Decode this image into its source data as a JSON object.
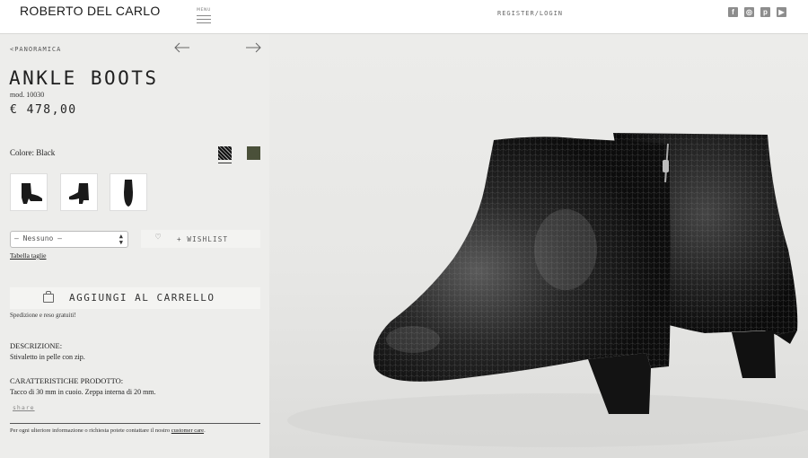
{
  "header": {
    "brand": "ROBERTO DEL CARLO",
    "menu_label": "MENU",
    "register_login": "REGISTER/LOGIN",
    "social": [
      "facebook-icon",
      "instagram-icon",
      "pinterest-icon",
      "youtube-icon"
    ]
  },
  "nav": {
    "back_label": "<PANORAMICA"
  },
  "product": {
    "title": "ANKLE BOOTS",
    "model": "mod. 10030",
    "price": "€ 478,00",
    "color_label": "Colore: Black",
    "swatches": [
      "black-texture",
      "olive-green"
    ],
    "size_select": "– Nessuno –",
    "wishlist_label": "+ WISHLIST",
    "size_chart_link": "Tabella taglie",
    "add_to_cart_label": "AGGIUNGI AL CARRELLO",
    "shipping_note": "Spedizione e reso gratuiti!",
    "description_label": "DESCRIZIONE:",
    "description_text": "Stivaletto in pelle con zip.",
    "features_label": "CARATTERISTICHE PRODOTTO:",
    "features_text": "Tacco di 30 mm in cuoio. Zeppa interna di 20 mm.",
    "share_label": "share",
    "footer_text": "Per ogni ulteriore informazione o richiesta potete contattare il nostro",
    "customer_care_link": "customer care",
    "footer_end": "."
  },
  "colors": {
    "header_bg": "#ffffff",
    "page_bg": "#ededeb",
    "olive_swatch": "#4a5039"
  }
}
